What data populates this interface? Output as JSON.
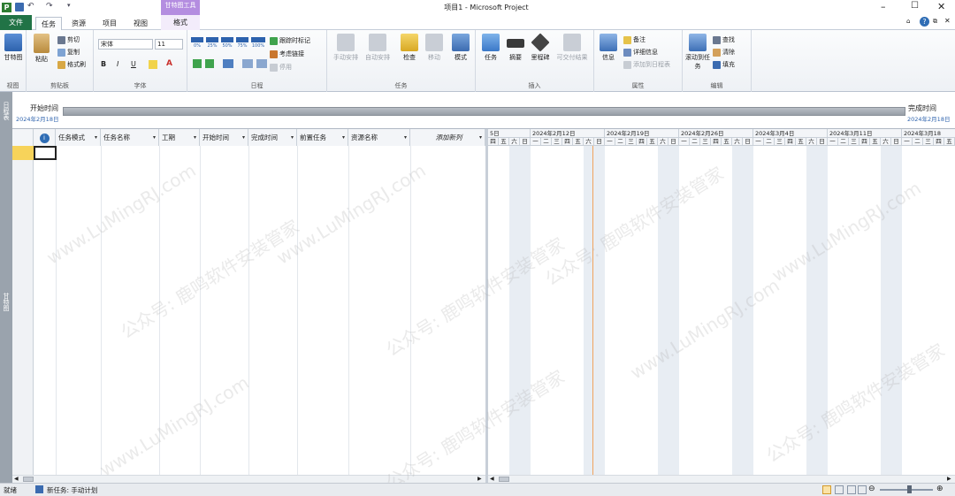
{
  "title_bar": {
    "title": "项目1 - Microsoft Project",
    "app_icon_letter": "P"
  },
  "contextual_tab": {
    "group_label": "甘特图工具",
    "tab_label": "格式"
  },
  "tabs": [
    {
      "label": "文件"
    },
    {
      "label": "任务"
    },
    {
      "label": "资源"
    },
    {
      "label": "项目"
    },
    {
      "label": "视图"
    }
  ],
  "ribbon": {
    "view_group": {
      "button": "甘特图",
      "label": "视图"
    },
    "clipboard_group": {
      "paste": "粘贴",
      "cut": "剪切",
      "copy": "复制",
      "format_painter": "格式刷",
      "label": "剪贴板"
    },
    "font_group": {
      "font_name": "宋体",
      "font_size": "11",
      "bold": "B",
      "italic": "I",
      "underline": "U",
      "font_color_glyph": "A",
      "label": "字体"
    },
    "schedule_group": {
      "percents": [
        "0%",
        "25%",
        "50%",
        "75%",
        "100%"
      ],
      "mark_on_track": "跟踪时标记",
      "respect_links": "考虑链接",
      "inactivate": "停用",
      "label": "日程"
    },
    "tasks_group": {
      "manual": "手动安排",
      "auto": "自动安排",
      "inspect": "检查",
      "move": "移动",
      "mode": "模式",
      "label": "任务"
    },
    "insert_group": {
      "task": "任务",
      "summary": "摘要",
      "milestone": "里程碑",
      "deliverable": "可交付结果",
      "label": "插入"
    },
    "properties_group": {
      "info": "信息",
      "notes": "备注",
      "details": "详细信息",
      "add_to_timeline": "添加到日程表",
      "label": "属性"
    },
    "editing_group": {
      "scroll_to_task": "滚动到任务",
      "find": "查找",
      "clear": "清除",
      "fill": "填充",
      "label": "编辑"
    }
  },
  "timeline": {
    "side_label": "日程表",
    "start_label": "开始时间",
    "start_date": "2024年2月18日",
    "finish_label": "完成时间",
    "finish_date": "2024年2月18日"
  },
  "left_view_label": "甘特图",
  "table": {
    "info_icon": "i",
    "columns": [
      "任务模式",
      "任务名称",
      "工期",
      "开始时间",
      "完成时间",
      "前置任务",
      "资源名称",
      "添加新列"
    ]
  },
  "gantt": {
    "weeks": [
      "5日",
      "2024年2月12日",
      "2024年2月19日",
      "2024年2月26日",
      "2024年3月4日",
      "2024年3月11日",
      "2024年3月18"
    ],
    "day_letters": [
      "四",
      "五",
      "六",
      "日",
      "一",
      "二",
      "三"
    ]
  },
  "status_bar": {
    "ready": "就绪",
    "new_task_mode": "新任务: 手动计划"
  },
  "watermark": {
    "text_a": "www.LuMingRJ.com",
    "text_b": "公众号: 鹿鸣软件安装管家"
  },
  "colors": {
    "file_tab": "#217346",
    "contextual": "#b48de0",
    "current_date_line": "#f0a35e",
    "nonworking": "#e8edf3"
  }
}
